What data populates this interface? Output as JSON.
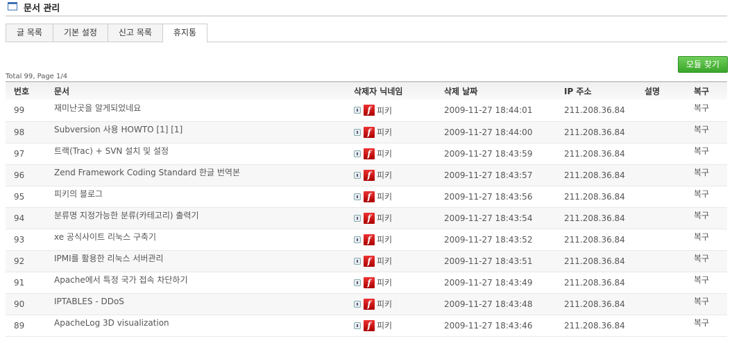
{
  "header": {
    "title": "문서 관리"
  },
  "tabs": [
    {
      "label": "글 목록"
    },
    {
      "label": "기본 설정"
    },
    {
      "label": "신고 목록"
    },
    {
      "label": "휴지통"
    }
  ],
  "toolbar": {
    "search_label": "모듈 찾기"
  },
  "summary": {
    "total_text": "Total 99, Page 1/4"
  },
  "table": {
    "headers": {
      "no": "번호",
      "doc": "문서",
      "nick": "삭제자 닉네임",
      "date": "삭제 날짜",
      "ip": "IP 주소",
      "desc": "설명",
      "restore": "복구"
    },
    "rows": [
      {
        "no": "99",
        "doc": "재미난곳을 알게되었네요",
        "nick": "피키",
        "date": "2009-11-27 18:44:01",
        "ip": "211.208.36.84",
        "restore": "복구"
      },
      {
        "no": "98",
        "doc": "Subversion 사용 HOWTO [1] [1]",
        "nick": "피키",
        "date": "2009-11-27 18:44:00",
        "ip": "211.208.36.84",
        "restore": "복구"
      },
      {
        "no": "97",
        "doc": "트랙(Trac) + SVN 설치 및 설정",
        "nick": "피키",
        "date": "2009-11-27 18:43:59",
        "ip": "211.208.36.84",
        "restore": "복구"
      },
      {
        "no": "96",
        "doc": "Zend Framework Coding Standard 한글 번역본",
        "nick": "피키",
        "date": "2009-11-27 18:43:57",
        "ip": "211.208.36.84",
        "restore": "복구"
      },
      {
        "no": "95",
        "doc": "피키의 블로그",
        "nick": "피키",
        "date": "2009-11-27 18:43:56",
        "ip": "211.208.36.84",
        "restore": "복구"
      },
      {
        "no": "94",
        "doc": "분류명 지정가능한 분류(카테고리) 출력기",
        "nick": "피키",
        "date": "2009-11-27 18:43:54",
        "ip": "211.208.36.84",
        "restore": "복구"
      },
      {
        "no": "93",
        "doc": "xe 공식사이트 리눅스 구축기",
        "nick": "피키",
        "date": "2009-11-27 18:43:52",
        "ip": "211.208.36.84",
        "restore": "복구"
      },
      {
        "no": "92",
        "doc": "IPMI를 활용한 리눅스 서버관리",
        "nick": "피키",
        "date": "2009-11-27 18:43:51",
        "ip": "211.208.36.84",
        "restore": "복구"
      },
      {
        "no": "91",
        "doc": "Apache에서 특정 국가 접속 차단하기",
        "nick": "피키",
        "date": "2009-11-27 18:43:49",
        "ip": "211.208.36.84",
        "restore": "복구"
      },
      {
        "no": "90",
        "doc": "IPTABLES - DDoS",
        "nick": "피키",
        "date": "2009-11-27 18:43:48",
        "ip": "211.208.36.84",
        "restore": "복구"
      },
      {
        "no": "89",
        "doc": "ApacheLog 3D visualization",
        "nick": "피키",
        "date": "2009-11-27 18:43:46",
        "ip": "211.208.36.84",
        "restore": "복구"
      }
    ]
  },
  "icons": {
    "status": "document-status-icon",
    "author": "flash-user-icon"
  },
  "colors": {
    "accent_green": "#3aa52a",
    "flash_red": "#cc1111",
    "title_icon_blue": "#3b6fb6"
  }
}
